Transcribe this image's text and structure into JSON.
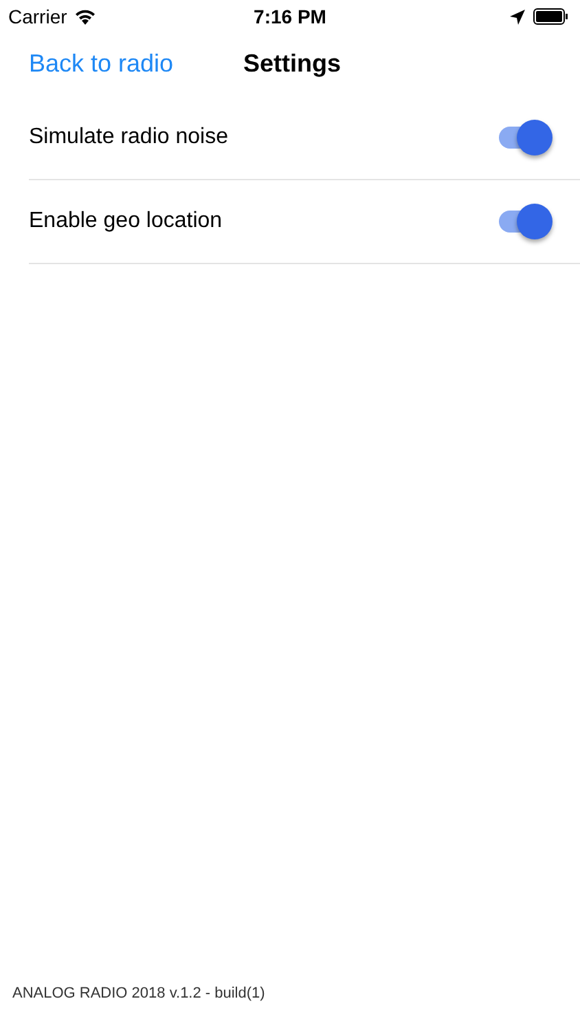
{
  "status_bar": {
    "carrier": "Carrier",
    "time": "7:16 PM"
  },
  "nav": {
    "back": "Back to radio",
    "title": "Settings"
  },
  "settings": [
    {
      "label": "Simulate radio noise",
      "on": true
    },
    {
      "label": "Enable geo location",
      "on": true
    }
  ],
  "footer": "ANALOG RADIO 2018 v.1.2 - build(1)"
}
